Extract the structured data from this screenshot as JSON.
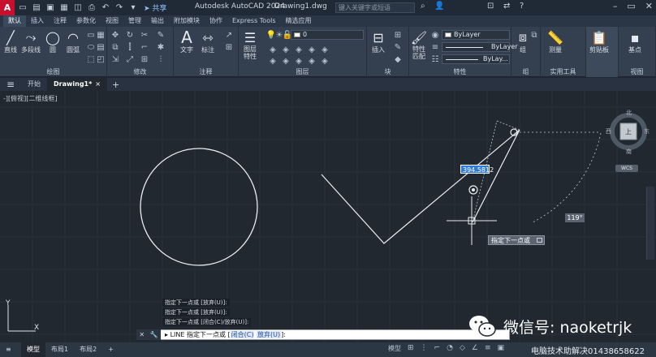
{
  "titlebar": {
    "logo": "A",
    "share": "共享",
    "app": "Autodesk AutoCAD 2024",
    "document": "Drawing1.dwg",
    "search_placeholder": "键入关键字或短语"
  },
  "ribbon_tabs": [
    "默认",
    "插入",
    "注释",
    "参数化",
    "视图",
    "管理",
    "输出",
    "附加模块",
    "协作",
    "Express Tools",
    "精选应用"
  ],
  "ribbon": {
    "draw": {
      "title": "绘图",
      "line": "直线",
      "polyline": "多段线",
      "circle": "圆",
      "arc": "圆弧"
    },
    "modify": {
      "title": "修改"
    },
    "annotation": {
      "title": "注释",
      "text": "文字",
      "dimension": "标注"
    },
    "layers": {
      "title": "图层",
      "layer_props": "图层\n特性",
      "layer_value": "0"
    },
    "block": {
      "title": "块",
      "insert": "插入"
    },
    "properties": {
      "title": "特性",
      "match": "特性\n匹配",
      "color": "ByLayer",
      "linetype": "ByLayer",
      "lineweight": "ByLay..."
    },
    "groups": {
      "title": "组",
      "group": "组"
    },
    "utilities": {
      "title": "实用工具",
      "measure": "测量"
    },
    "clipboard": {
      "title": "剪贴板",
      "paste": "剪贴板"
    },
    "base": {
      "title": "视图",
      "base": "基点"
    }
  },
  "doc_tabs": {
    "start": "开始",
    "drawing": "Drawing1*",
    "close": "×"
  },
  "viewport_label": "-][俯视][二维线框]",
  "dynamic_input": "394.5812",
  "angle_tip": "119°",
  "prompt_tip": "指定下一点或",
  "viewcube": {
    "north": "北",
    "south": "南",
    "east": "东",
    "west": "西",
    "face": "上",
    "wcs": "WCS"
  },
  "command_history": [
    "指定下一点或 [放弃(U)]:",
    "指定下一点或 [放弃(U)]:",
    "指定下一点或 [闭合(C)/放弃(U)]:"
  ],
  "command_line": {
    "prefix": "LINE 指定下一点或 [",
    "opt1": "闭合(C)",
    "opt2": "放弃(U)",
    "suffix": "]:"
  },
  "ucs": {
    "x": "X",
    "y": "Y"
  },
  "status_tabs": [
    "模型",
    "布局1",
    "布局2"
  ],
  "status_model": "模型",
  "watermark": {
    "text": "微信号: naoketrjk",
    "sub": "电脑技术助解决01438658622"
  }
}
